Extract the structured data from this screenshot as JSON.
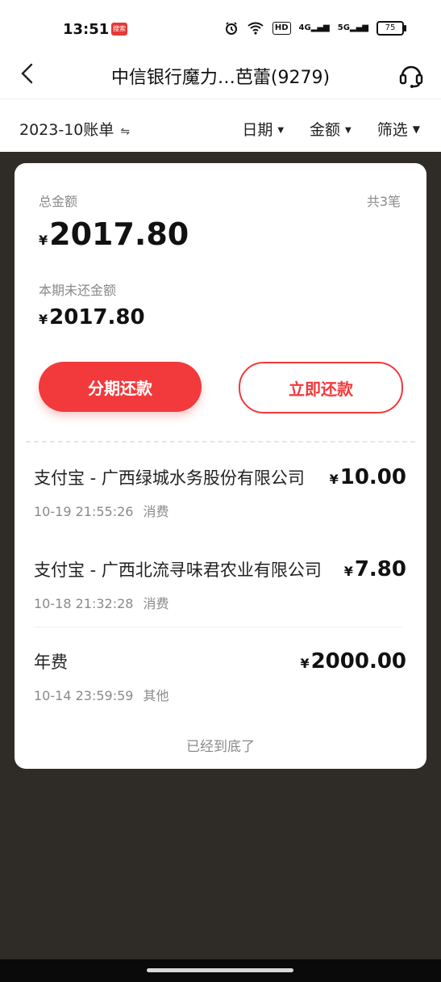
{
  "status": {
    "time": "13:51",
    "app_badge": "搜索",
    "hd": "HD",
    "net1": "4G",
    "net2": "5G",
    "battery": "75"
  },
  "nav": {
    "title": "中信银行魔力…芭蕾(9279)"
  },
  "filter": {
    "period": "2023-10账单",
    "date_label": "日期",
    "amount_label": "金额",
    "filter_label": "筛选"
  },
  "summary": {
    "total_label": "总金额",
    "count_text": "共3笔",
    "currency": "¥",
    "total_amount": "2017.80",
    "unpaid_label": "本期未还金额",
    "unpaid_amount": "2017.80"
  },
  "buttons": {
    "installment": "分期还款",
    "pay_now": "立即还款"
  },
  "transactions": [
    {
      "merchant": "支付宝 - 广西绿城水务股份有限公司",
      "amount": "10.00",
      "datetime": "10-19 21:55:26",
      "type": "消费"
    },
    {
      "merchant": "支付宝 - 广西北流寻味君农业有限公司",
      "amount": "7.80",
      "datetime": "10-18 21:32:28",
      "type": "消费"
    },
    {
      "merchant": "年费",
      "amount": "2000.00",
      "datetime": "10-14 23:59:59",
      "type": "其他"
    }
  ],
  "footer": {
    "end_text": "已经到底了"
  }
}
